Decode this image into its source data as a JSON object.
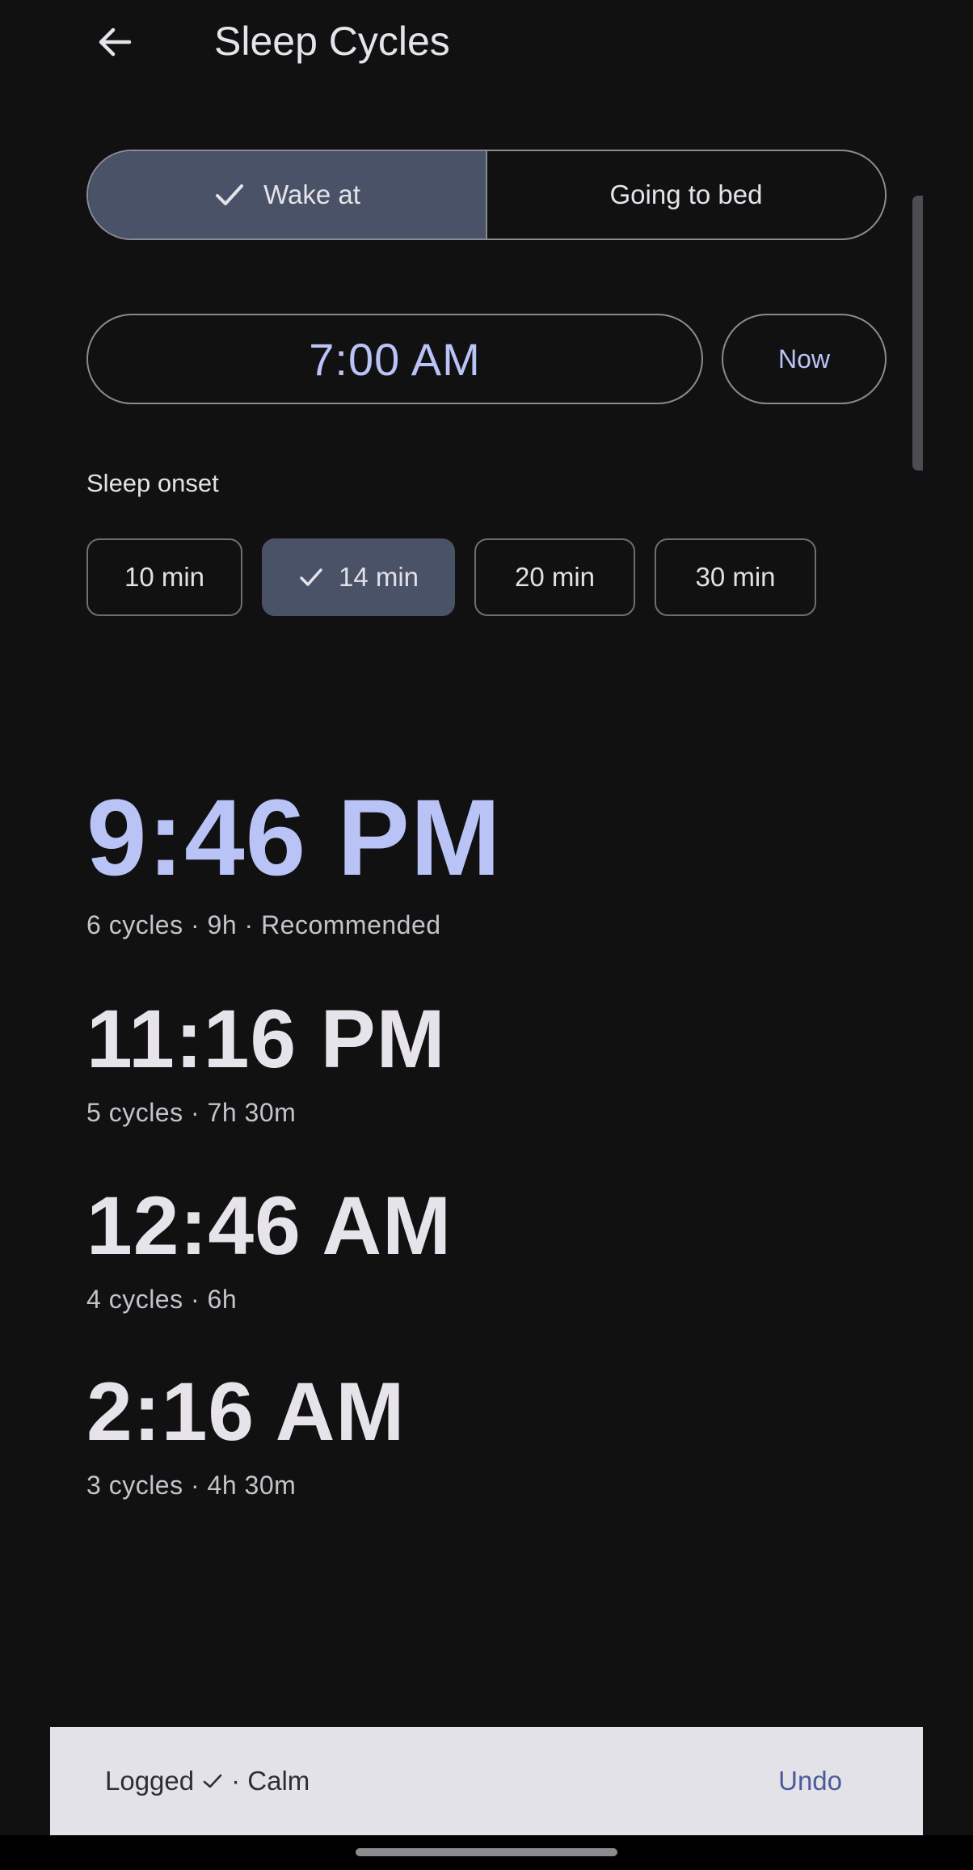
{
  "header": {
    "title": "Sleep Cycles",
    "back_icon": "arrow-left-icon"
  },
  "mode": {
    "options": [
      {
        "label": "Wake at",
        "selected": true
      },
      {
        "label": "Going to bed",
        "selected": false
      }
    ],
    "check_icon": "check-icon"
  },
  "time": {
    "value": "7:00 AM",
    "now_label": "Now"
  },
  "onset": {
    "label": "Sleep onset",
    "options": [
      {
        "label": "10 min",
        "selected": false
      },
      {
        "label": "14 min",
        "selected": true
      },
      {
        "label": "20 min",
        "selected": false
      },
      {
        "label": "30 min",
        "selected": false
      }
    ]
  },
  "results": [
    {
      "time": "9:46 PM",
      "meta": "6 cycles · 9h · Recommended",
      "recommended": true
    },
    {
      "time": "11:16 PM",
      "meta": "5 cycles · 7h 30m",
      "recommended": false
    },
    {
      "time": "12:46 AM",
      "meta": "4 cycles · 6h",
      "recommended": false
    },
    {
      "time": "2:16 AM",
      "meta": "3 cycles · 4h 30m",
      "recommended": false
    }
  ],
  "snackbar": {
    "text_before": "Logged",
    "text_after": "· Calm",
    "action": "Undo"
  },
  "colors": {
    "background": "#111112",
    "accent": "#b9c3f6",
    "selected_fill": "#4a5268",
    "snackbar_bg": "#e3e2e8",
    "snackbar_action": "#4a5b9a"
  }
}
